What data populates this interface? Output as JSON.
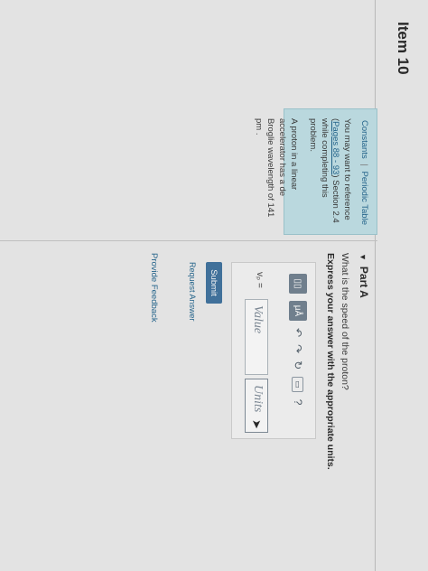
{
  "item": {
    "title": "Item 10"
  },
  "info": {
    "constants_link": "Constants",
    "separator": "|",
    "periodic_link": "Periodic Table",
    "ref_prefix": "You may want to reference (",
    "ref_link": "Pages 88 - 93",
    "ref_suffix": ") Section 2.4 while completing this problem.",
    "problem": "A proton in a linear accelerator has a de Broglie wavelength of 141 pm ."
  },
  "part": {
    "title": "Part A",
    "question": "What is the speed of the proton?",
    "instruction": "Express your answer with the appropriate units."
  },
  "answer": {
    "toolbar": {
      "templates_icon": "▯▯",
      "units_label": "μÅ",
      "undo_icon": "↶",
      "redo_icon": "↷",
      "reset_icon": "↻",
      "keyboard_label": "▭",
      "help_icon": "?"
    },
    "label": "vₚ =",
    "value_placeholder": "Value",
    "units_placeholder": "Units"
  },
  "actions": {
    "submit": "Submit",
    "request_answer": "Request Answer",
    "provide_feedback": "Provide Feedback"
  }
}
